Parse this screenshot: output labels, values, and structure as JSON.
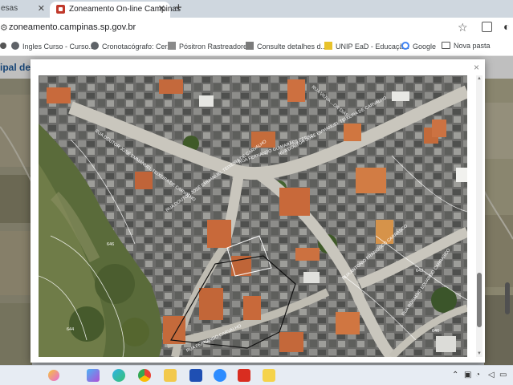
{
  "browser": {
    "prev_tab_label": "esas",
    "active_tab": {
      "title": "Zoneamento On-line Campinas"
    },
    "new_tab_symbol": "+",
    "url": "zoneamento.campinas.sp.gov.br",
    "bookmarks": [
      {
        "label": "Ingles Curso - Curso...",
        "icon": "globe-icon"
      },
      {
        "label": "Cronotacógrafo: Cer...",
        "icon": "globe-icon"
      },
      {
        "label": "Pósitron Rastreadores",
        "icon": "grid-icon"
      },
      {
        "label": "Consulte detalhes d...",
        "icon": "doc-icon"
      },
      {
        "label": "UNIP EaD - Educaçã...",
        "icon": "unip-icon"
      },
      {
        "label": "Google",
        "icon": "google-icon"
      },
      {
        "label": "Nova pasta",
        "icon": "folder-icon"
      }
    ]
  },
  "site": {
    "header_title": "ipal de C"
  },
  "modal": {
    "close_symbol": "×",
    "street_labels": [
      "RUA DOUTOR JOSÉ EMMANUEL TEIXEIRA DE CARVALHO",
      "RUA DOUTOR JOSÉ EMMANUEL TEIXEIRA DE CARVALHO",
      "RUA FERNANDO GUIMARÃES PERES",
      "RUA VIÚVA ...OR DIAS",
      "RUA DOUTOR JOSÉ EMMANUEL TEIXEIRA DE CARVALHO",
      "RUA ANTONIO FRANCISCO CARRASCO",
      "RUA ROSALVO EDUARDO CARRASCO",
      "RUA FERNANDO CARVALHO"
    ],
    "contour_labels": [
      "646",
      "644",
      "642",
      "646"
    ]
  },
  "colors": {
    "accent": "#1c5a9c",
    "tab_bar": "#cfd7df",
    "favicon": "#c0392b"
  }
}
